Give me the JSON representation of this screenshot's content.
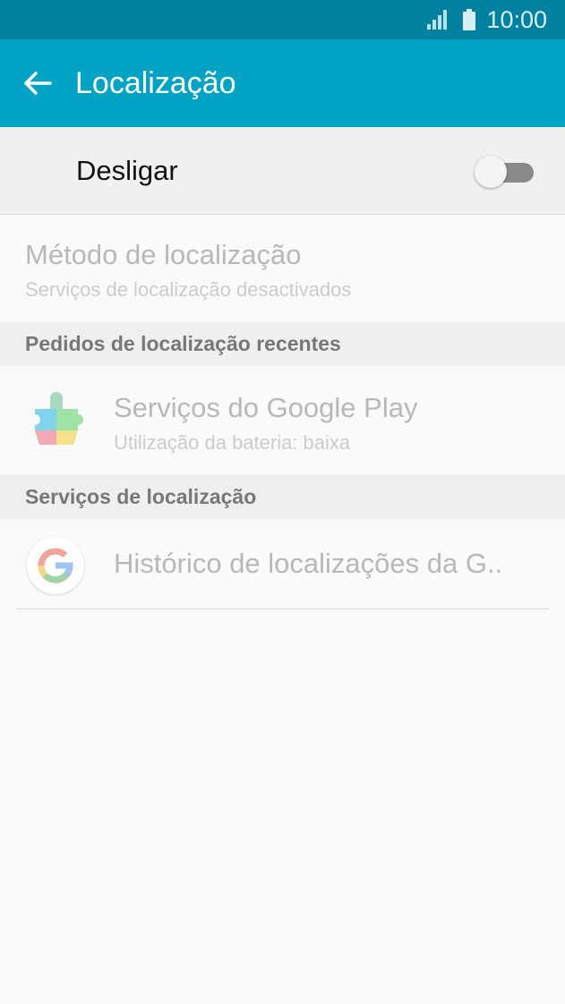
{
  "status_bar": {
    "time": "10:00",
    "signal_icon": "signal-icon",
    "battery_icon": "battery-icon"
  },
  "app_bar": {
    "title": "Localização",
    "back_icon": "arrow-back-icon",
    "color": "#00a3c4"
  },
  "master_switch": {
    "label": "Desligar",
    "state": "off"
  },
  "location_method": {
    "title": "Método de localização",
    "subtitle": "Serviços de localização desactivados"
  },
  "recent_requests": {
    "header": "Pedidos de localização recentes",
    "items": [
      {
        "title": "Serviços do Google Play",
        "subtitle": "Utilização da bateria: baixa",
        "icon": "google-play-services-icon"
      }
    ]
  },
  "location_services": {
    "header": "Serviços de localização",
    "items": [
      {
        "title": "Histórico de localizações da G..",
        "icon": "google-icon"
      }
    ]
  }
}
